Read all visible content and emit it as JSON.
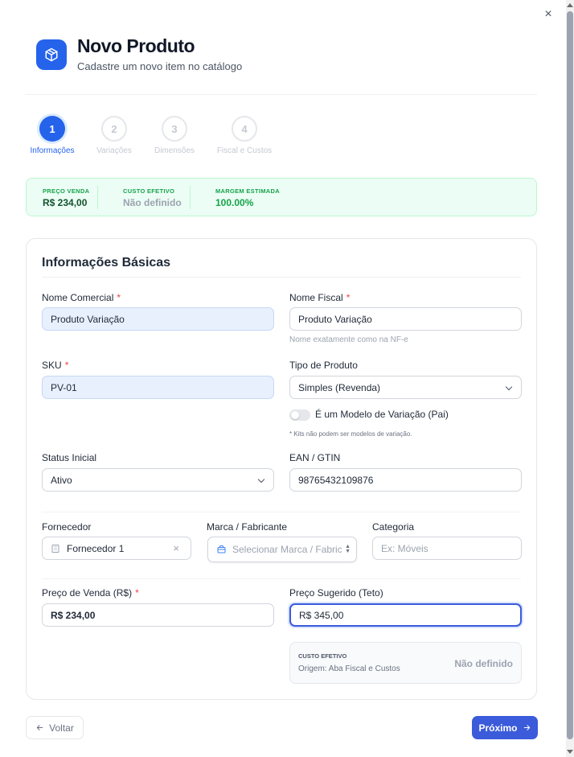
{
  "header": {
    "title": "Novo Produto",
    "subtitle": "Cadastre um novo item no catálogo",
    "icon": "package-icon",
    "accent_color": "#2563eb"
  },
  "close_label": "×",
  "stepper": {
    "steps": [
      {
        "number": "1",
        "label": "Informações",
        "active": true
      },
      {
        "number": "2",
        "label": "Variações",
        "active": false
      },
      {
        "number": "3",
        "label": "Dimensões",
        "active": false
      },
      {
        "number": "4",
        "label": "Fiscal e Custos",
        "active": false
      }
    ]
  },
  "summary": {
    "price": {
      "label": "PREÇO VENDA",
      "value": "R$ 234,00"
    },
    "cost": {
      "label": "CUSTO EFETIVO",
      "value": "Não definido"
    },
    "margin": {
      "label": "MARGEM ESTIMADA",
      "value": "100.00%"
    }
  },
  "form": {
    "section_title": "Informações Básicas",
    "nome_comercial": {
      "label": "Nome Comercial",
      "required": "*",
      "value": "Produto Variação"
    },
    "nome_fiscal": {
      "label": "Nome Fiscal",
      "required": "*",
      "value": "Produto Variação",
      "hint": "Nome exatamente como na NF-e"
    },
    "sku": {
      "label": "SKU",
      "required": "*",
      "value": "PV-01"
    },
    "tipo_produto": {
      "label": "Tipo de Produto",
      "value": "Simples (Revenda)"
    },
    "variation_toggle": {
      "label": "É um Modelo de Variação (Pai)",
      "checked": false,
      "hint": "* Kits não podem ser modelos de variação."
    },
    "status_inicial": {
      "label": "Status Inicial",
      "value": "Ativo"
    },
    "ean": {
      "label": "EAN / GTIN",
      "value": "98765432109876"
    },
    "fornecedor": {
      "label": "Fornecedor",
      "value": "Fornecedor 1",
      "clear": "×"
    },
    "marca": {
      "label": "Marca / Fabricante",
      "placeholder": "Selecionar Marca / Fabricante"
    },
    "categoria": {
      "label": "Categoria",
      "placeholder": "Ex: Móveis"
    },
    "preco_venda": {
      "label": "Preço de Venda (R$)",
      "required": "*",
      "value": "R$ 234,00"
    },
    "preco_sugerido": {
      "label": "Preço Sugerido (Teto)",
      "value": "R$ 345,00"
    },
    "custo_efetivo": {
      "label": "CUSTO EFETIVO",
      "origin": "Origem: Aba Fiscal e Custos",
      "value": "Não definido"
    }
  },
  "footer": {
    "back_label": "Voltar",
    "next_label": "Próximo"
  }
}
